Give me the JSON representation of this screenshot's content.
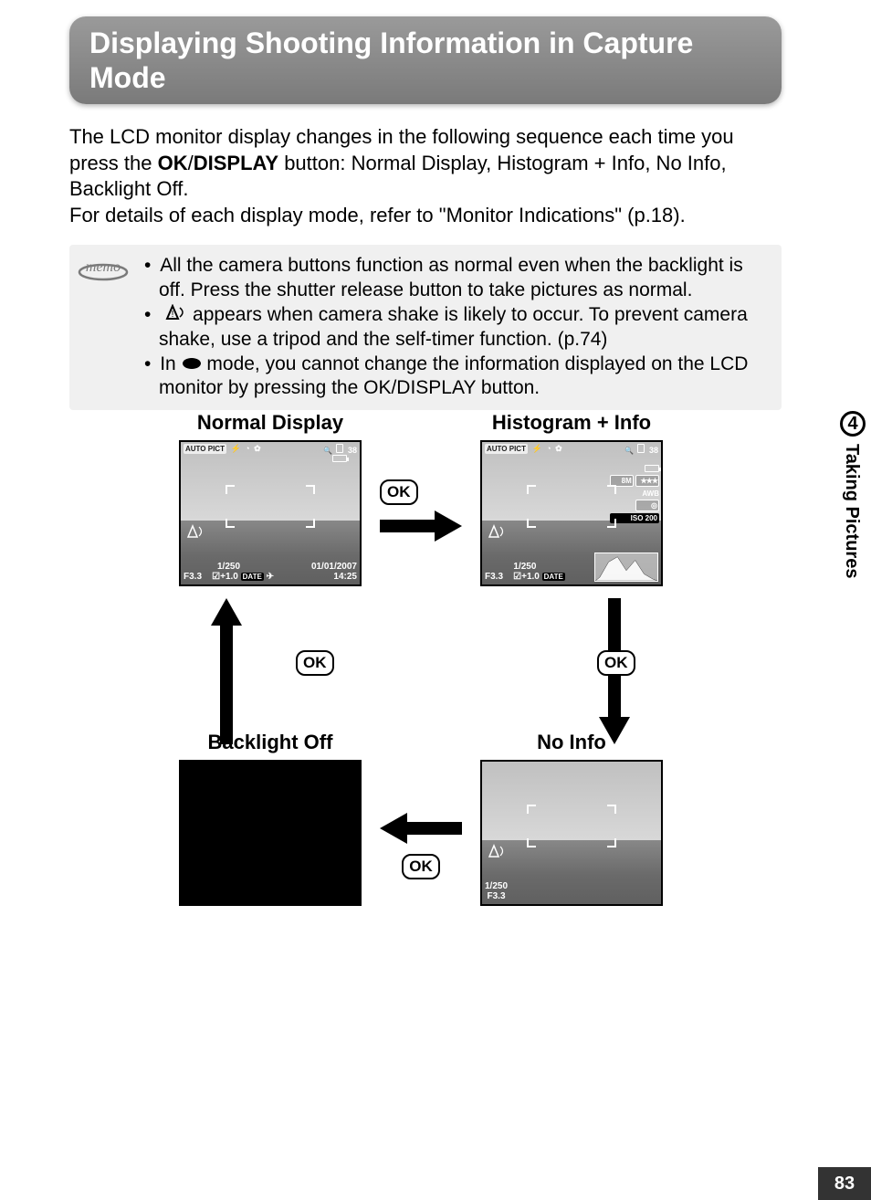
{
  "title": "Displaying Shooting Information in Capture Mode",
  "intro": {
    "line1_prefix": "The LCD monitor display changes in the following sequence each time you press the ",
    "ok": "OK",
    "slash": "/",
    "display": "DISPLAY",
    "line1_suffix": " button: Normal Display, Histogram + Info, No Info, Backlight Off.",
    "line2": "For details of each display mode, refer to \"Monitor Indications\" (p.18)."
  },
  "memo": {
    "label": "memo",
    "items": [
      {
        "text": "All the camera buttons function as normal even when the backlight is off. Press the shutter release button to take pictures as normal."
      },
      {
        "prefix": " ",
        "suffix": " appears when camera shake is likely to occur. To prevent camera shake, use a tripod and the self-timer function. (p.74)"
      },
      {
        "prefix": "In ",
        "mid": " mode, you cannot change the information displayed on the LCD monitor by pressing the ",
        "ok": "OK",
        "slash": "/",
        "display": "DISPLAY",
        "suffix": " button."
      }
    ]
  },
  "side": {
    "chapter": "4",
    "label": "Taking Pictures"
  },
  "page_number": "83",
  "ok_label": "OK",
  "screens": {
    "normal": {
      "caption": "Normal Display",
      "auto": "AUTO PICT",
      "count": "38",
      "shutter": "1/250",
      "aperture": "F3.3",
      "ev": "+1.0",
      "date": "01/01/2007",
      "date_badge": "DATE",
      "time": "14:25"
    },
    "histogram": {
      "caption": "Histogram + Info",
      "auto": "AUTO PICT",
      "count": "38",
      "size": "8M",
      "wb": "AWB",
      "iso": "ISO 200",
      "shutter": "1/250",
      "aperture": "F3.3",
      "ev": "+1.0",
      "date_badge": "DATE"
    },
    "backlight": {
      "caption": "Backlight Off"
    },
    "noinfo": {
      "caption": "No Info",
      "shutter": "1/250",
      "aperture": "F3.3"
    }
  }
}
